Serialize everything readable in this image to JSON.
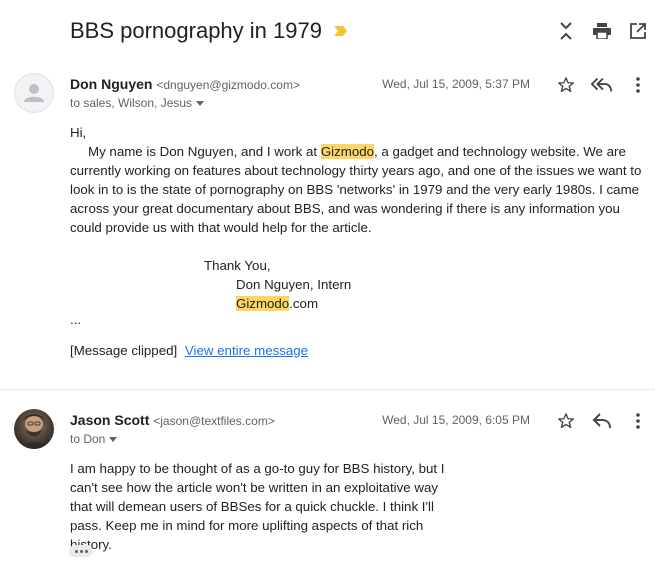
{
  "thread": {
    "subject": "BBS pornography in 1979",
    "label_color": "#f4c430"
  },
  "toolbar": {
    "icons": [
      "collapse-all-icon",
      "print-icon",
      "open-new-window-icon"
    ]
  },
  "messages": [
    {
      "sender_name": "Don Nguyen",
      "sender_email": "<dnguyen@gizmodo.com>",
      "to": "to sales, Wilson, Jesus",
      "date": "Wed, Jul 15, 2009, 5:37 PM",
      "greeting": "Hi,",
      "p1_a": "My name is Don Nguyen, and I work at ",
      "p1_hl": "Gizmodo",
      "p1_b": ", a gadget and technology website. We are currently working on features about technology thirty years ago, and one of the issues we want to look in to is the state of pornography on BBS 'networks' in 1979 and the very early 1980s. I came across your great documentary about BBS, and was wondering if there is any information you could provide us with that would help for the article.",
      "signoff": "Thank You,",
      "sig_name": "Don Nguyen, Intern",
      "sig_site_hl": "Gizmodo",
      "sig_site_rest": ".com",
      "ellipsis": "...",
      "clipped": "[Message clipped]",
      "view_entire": "View entire message"
    },
    {
      "sender_name": "Jason Scott",
      "sender_email": "<jason@textfiles.com>",
      "to": "to Don",
      "date": "Wed, Jul 15, 2009, 6:05 PM",
      "body": "I am happy to be thought of as a go-to guy for BBS history, but I can't see how the article won't be written in an exploitative way that will demean users of BBSes for a quick chuckle. I think I'll pass. Keep me in mind for more uplifting aspects of that rich history."
    }
  ]
}
